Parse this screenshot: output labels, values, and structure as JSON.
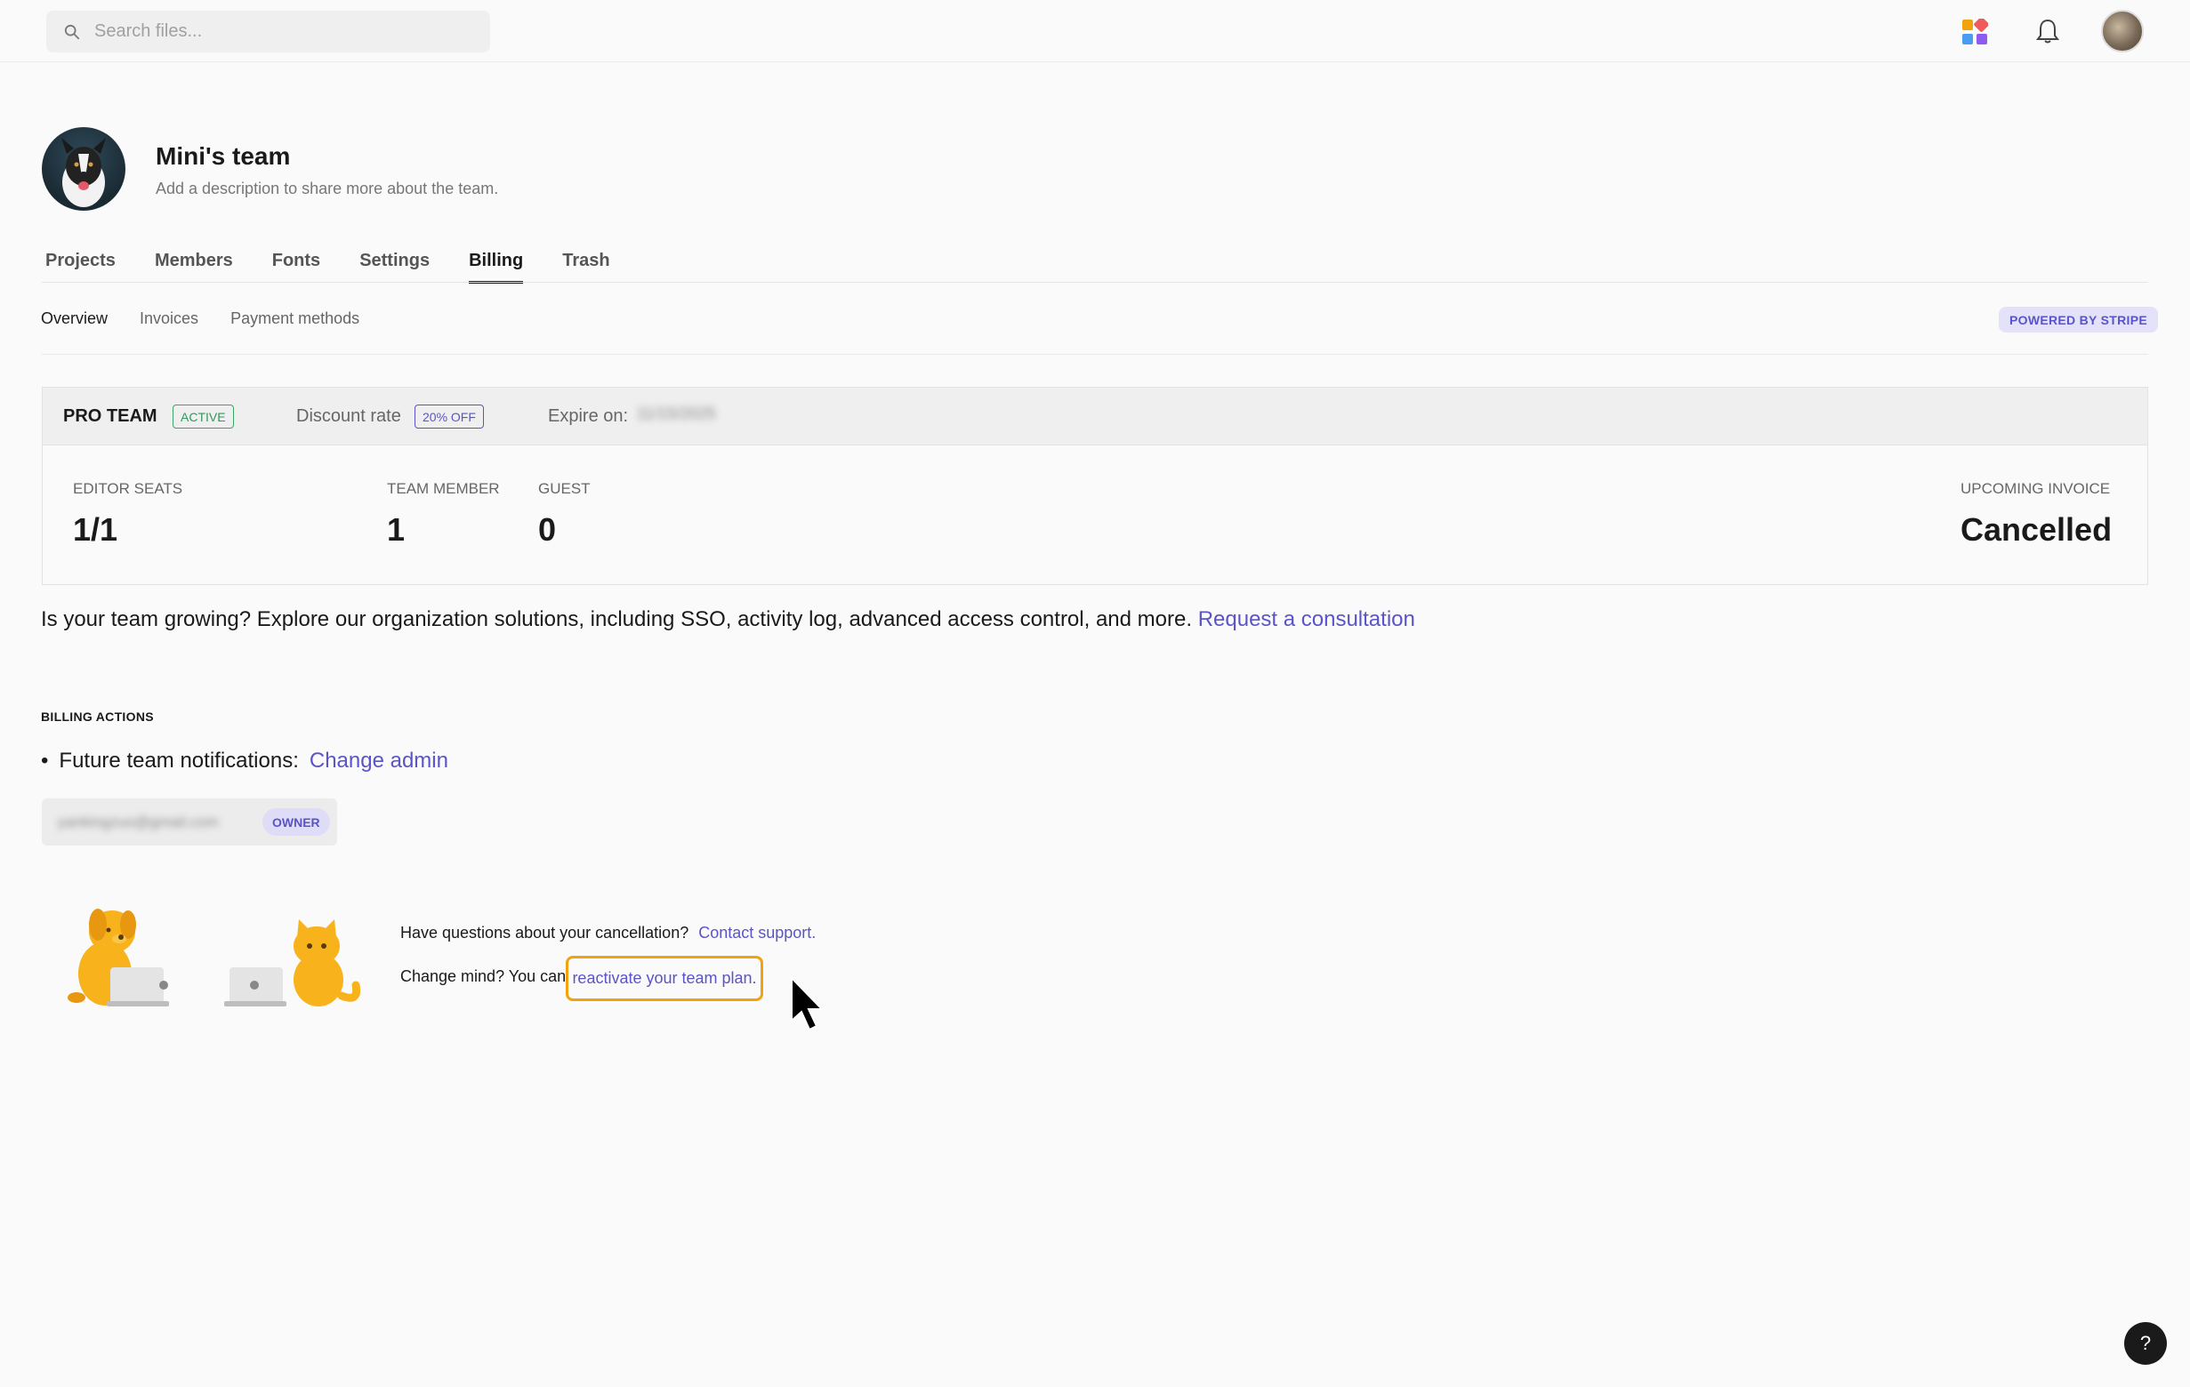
{
  "search": {
    "placeholder": "Search files..."
  },
  "team": {
    "name": "Mini's team",
    "description": "Add a description to share more about the team."
  },
  "tabs": [
    {
      "label": "Projects",
      "active": false
    },
    {
      "label": "Members",
      "active": false
    },
    {
      "label": "Fonts",
      "active": false
    },
    {
      "label": "Settings",
      "active": false
    },
    {
      "label": "Billing",
      "active": true
    },
    {
      "label": "Trash",
      "active": false
    }
  ],
  "subtabs": [
    {
      "label": "Overview",
      "active": true
    },
    {
      "label": "Invoices",
      "active": false
    },
    {
      "label": "Payment methods",
      "active": false
    }
  ],
  "stripe_badge": "POWERED BY STRIPE",
  "plan": {
    "name": "PRO TEAM",
    "status": "ACTIVE",
    "discount_label": "Discount rate",
    "discount_value": "20% OFF",
    "expire_label": "Expire on:",
    "expire_value": "11/15/2025",
    "stats": {
      "editor_seats_label": "EDITOR SEATS",
      "editor_seats_value": "1/1",
      "team_member_label": "TEAM MEMBER",
      "team_member_value": "1",
      "guest_label": "GUEST",
      "guest_value": "0",
      "upcoming_label": "UPCOMING INVOICE",
      "upcoming_value": "Cancelled"
    }
  },
  "promo": {
    "text": "Is your team growing? Explore our organization solutions, including SSO, activity log, advanced access control, and more.",
    "link": "Request a consultation"
  },
  "billing_actions": {
    "title": "BILLING ACTIONS",
    "future_label": "Future team notifications:",
    "change_admin": "Change admin",
    "owner_email": "yankingzuo@gmail.com",
    "owner_badge": "OWNER"
  },
  "cancellation": {
    "question": "Have questions about your cancellation?",
    "contact": "Contact support.",
    "change_mind": "Change mind? You can",
    "reactivate": "reactivate your team plan."
  },
  "help": "?",
  "colors": {
    "accent": "#5a54c8",
    "active_green": "#2e9a5a",
    "highlight": "#f2a20c"
  }
}
